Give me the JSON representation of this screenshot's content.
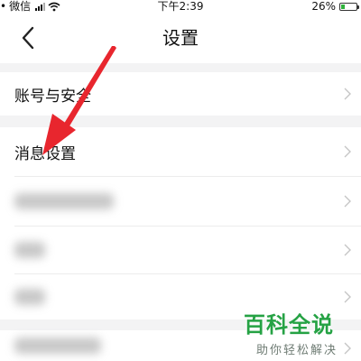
{
  "status_bar": {
    "carrier": "微信",
    "time": "下午2:39",
    "battery_percent": "26%",
    "battery_level": 0.26
  },
  "nav": {
    "title": "设置"
  },
  "settings": {
    "account_security": "账号与安全",
    "message_settings": "消息设置"
  },
  "watermark": {
    "title": "百科全说",
    "subtitle": "助你轻松解决"
  },
  "colors": {
    "accent": "#25a244",
    "annotation_arrow": "#e8262e",
    "section_gap": "#f3f3f4"
  }
}
